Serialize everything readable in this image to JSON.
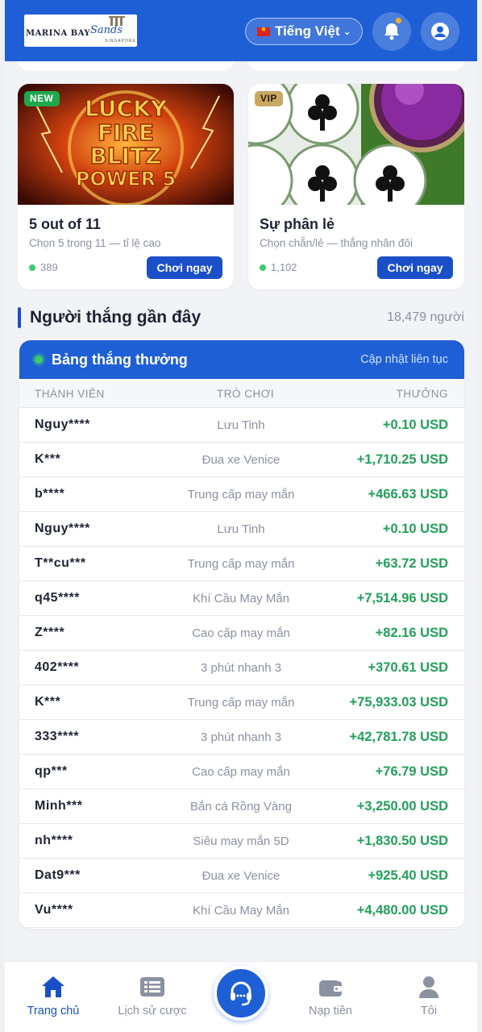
{
  "header": {
    "logo_main": "MARINA BAY",
    "logo_brand": "Sands",
    "logo_sub": "SINGAPORE",
    "language": "Tiếng Việt"
  },
  "cards": [
    {
      "badge": "NEW",
      "title": "5 out of 11",
      "subtitle": "Chọn 5 trong 11 — tỉ lệ cao",
      "players": "389",
      "play_label": "Chơi ngay",
      "art_text": [
        "LUCKY",
        "FIRE",
        "BLITZ",
        "POWER 5"
      ]
    },
    {
      "badge": "VIP",
      "title": "Sự phân lẻ",
      "subtitle": "Chọn chẵn/lẻ — thắng nhân đôi",
      "players": "1,102",
      "play_label": "Chơi ngay"
    }
  ],
  "winners": {
    "title": "Người thắng gần đây",
    "count": "18,479 người",
    "board_title": "Bảng thắng thưởng",
    "board_status": "Cập nhật liên tục",
    "columns": [
      "THÀNH VIÊN",
      "TRÒ CHƠI",
      "THƯỞNG"
    ],
    "rows": [
      {
        "member": "Nguy****",
        "game": "Lưu Tinh",
        "prize": "+0.10 USD"
      },
      {
        "member": "K***",
        "game": "Đua xe Venice",
        "prize": "+1,710.25 USD"
      },
      {
        "member": "b****",
        "game": "Trung cấp may mắn",
        "prize": "+466.63 USD"
      },
      {
        "member": "Nguy****",
        "game": "Lưu Tinh",
        "prize": "+0.10 USD"
      },
      {
        "member": "T**cu***",
        "game": "Trung cấp may mắn",
        "prize": "+63.72 USD"
      },
      {
        "member": "q45****",
        "game": "Khí Cầu May Mắn",
        "prize": "+7,514.96 USD"
      },
      {
        "member": "Z****",
        "game": "Cao cấp may mắn",
        "prize": "+82.16 USD"
      },
      {
        "member": "402****",
        "game": "3 phút nhanh 3",
        "prize": "+370.61 USD"
      },
      {
        "member": "K***",
        "game": "Trung cấp may mắn",
        "prize": "+75,933.03 USD"
      },
      {
        "member": "333****",
        "game": "3 phút nhanh 3",
        "prize": "+42,781.78 USD"
      },
      {
        "member": "qp***",
        "game": "Cao cấp may mắn",
        "prize": "+76.79 USD"
      },
      {
        "member": "Minh***",
        "game": "Bắn cá Rồng Vàng",
        "prize": "+3,250.00 USD"
      },
      {
        "member": "nh****",
        "game": "Siêu may mắn 5D",
        "prize": "+1,830.50 USD"
      },
      {
        "member": "Dat9***",
        "game": "Đua xe Venice",
        "prize": "+925.40 USD"
      },
      {
        "member": "Vu****",
        "game": "Khí Cầu May Mắn",
        "prize": "+4,480.00 USD"
      }
    ]
  },
  "nav": {
    "home": "Trang chủ",
    "history": "Lịch sử cược",
    "deposit": "Nạp tiền",
    "me": "Tôi"
  },
  "colors": {
    "primary": "#1f5fd6",
    "button": "#1a4fc7",
    "prize": "#22a05a"
  }
}
